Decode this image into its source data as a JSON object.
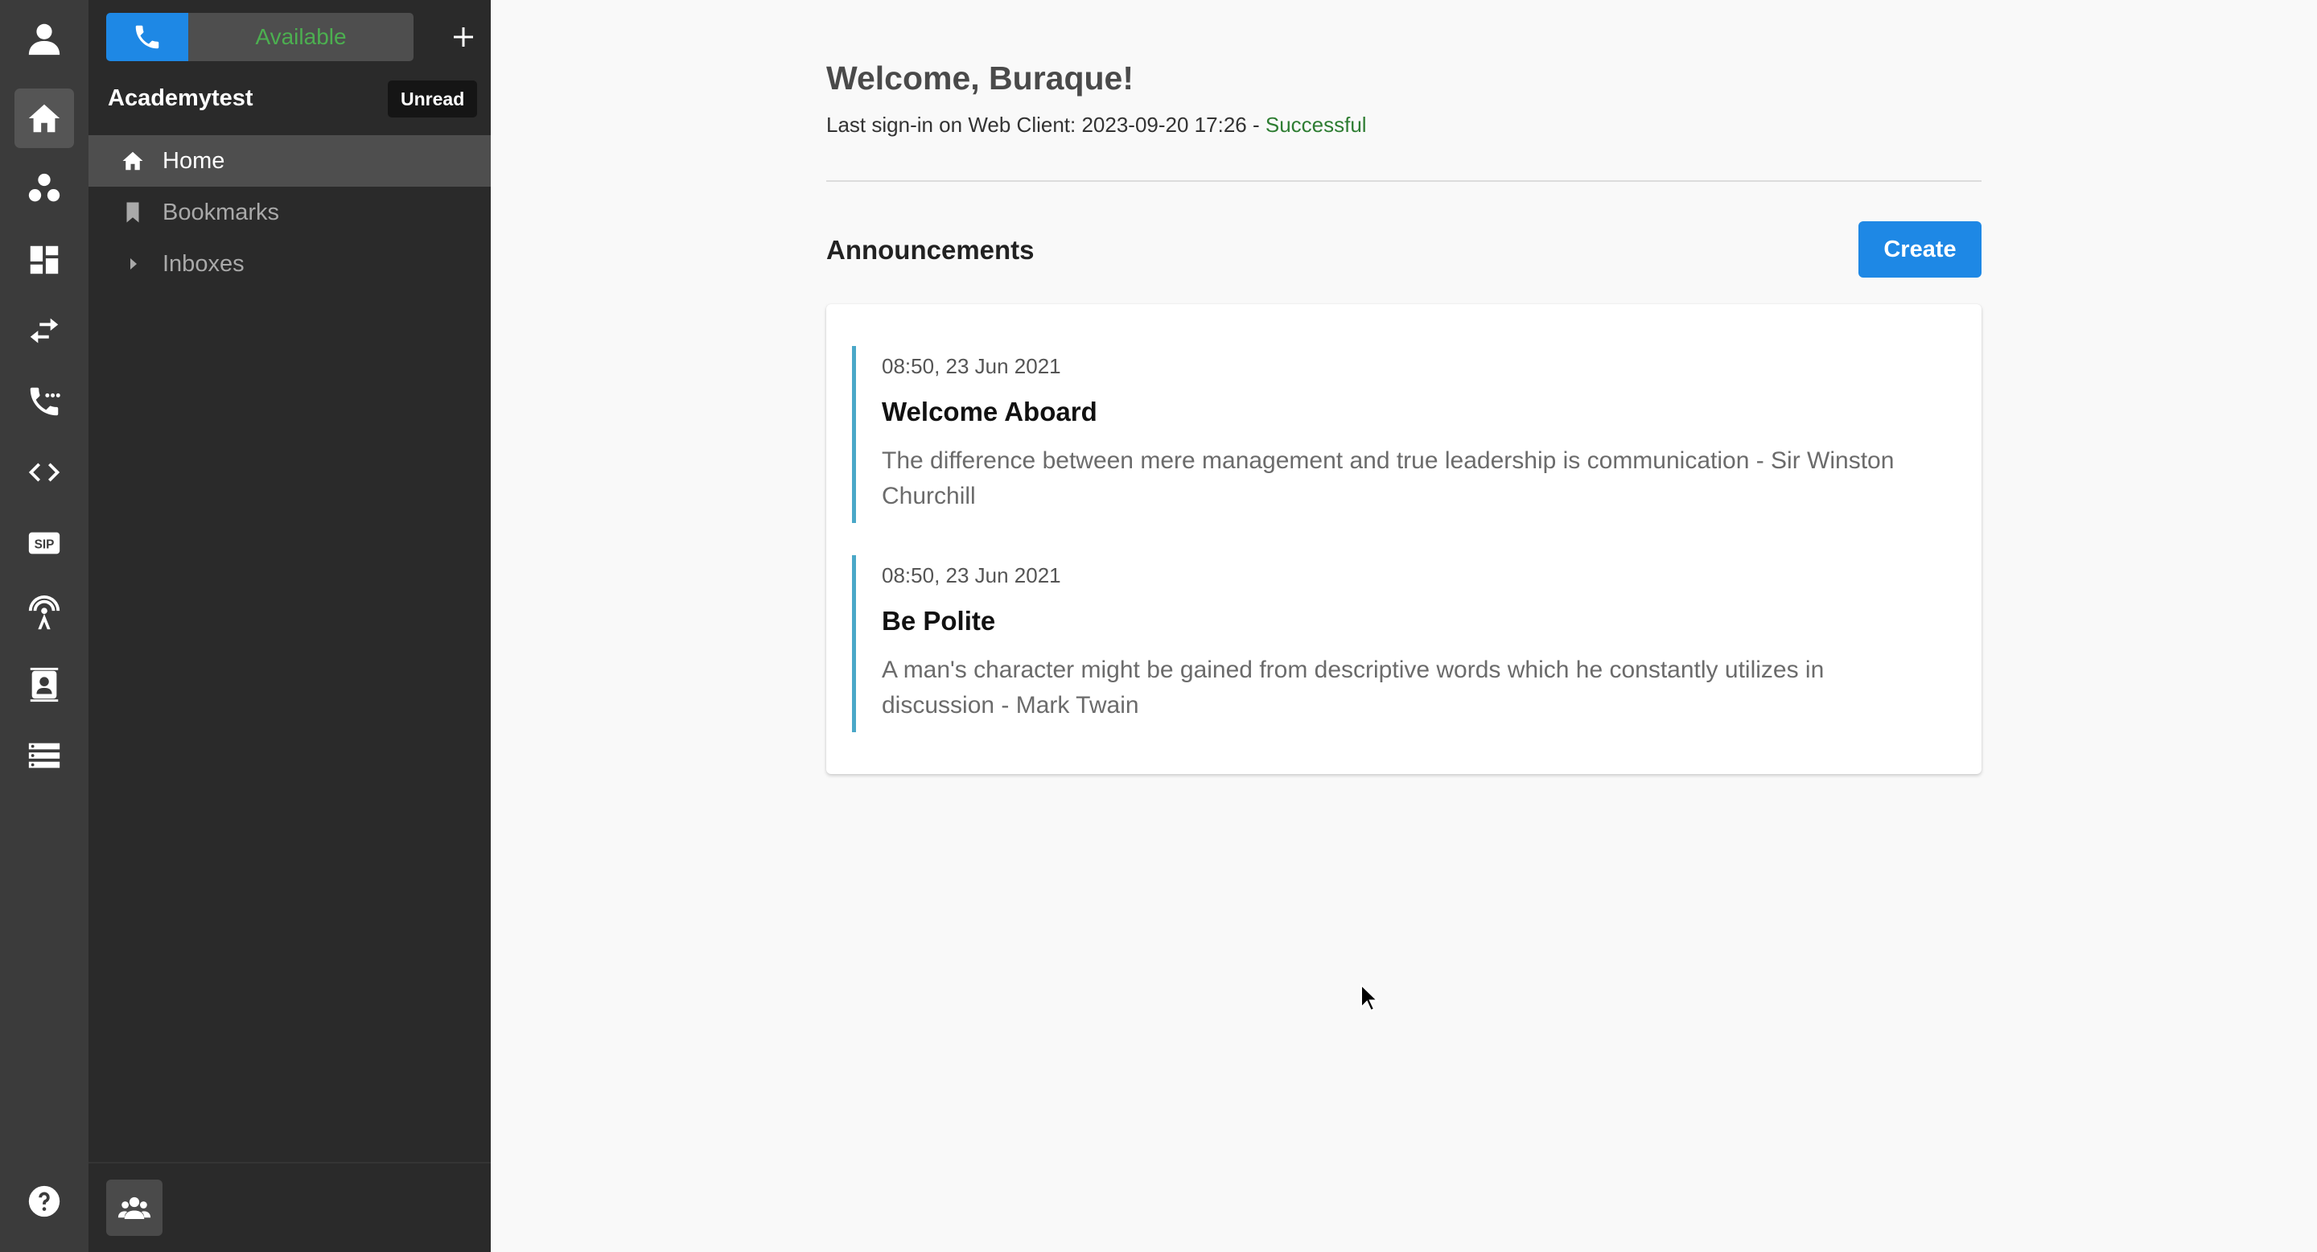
{
  "rail": {
    "icons": [
      "user-icon",
      "home-icon",
      "contacts-group-icon",
      "dashboard-icon",
      "swap-arrows-icon",
      "phone-call-icon",
      "code-icon",
      "sip-icon",
      "broadcast-icon",
      "address-book-icon",
      "server-list-icon",
      "help-icon"
    ],
    "sip_label": "SIP"
  },
  "sidebar": {
    "status": "Available",
    "tenant": "Academytest",
    "unread_label": "Unread",
    "items": [
      {
        "label": "Home",
        "icon": "home-icon",
        "active": true
      },
      {
        "label": "Bookmarks",
        "icon": "bookmark-icon",
        "active": false
      },
      {
        "label": "Inboxes",
        "icon": "caret-right-icon",
        "active": false
      }
    ]
  },
  "main": {
    "welcome": "Welcome, Buraque!",
    "last_signin_prefix": "Last sign-in on Web Client: 2023-09-20 17:26 - ",
    "last_signin_status": "Successful",
    "announcements_title": "Announcements",
    "create_label": "Create",
    "announcements": [
      {
        "date": "08:50, 23 Jun 2021",
        "title": "Welcome Aboard",
        "body": "The difference between mere management and true leadership is communication - Sir Winston Churchill"
      },
      {
        "date": "08:50, 23 Jun 2021",
        "title": "Be Polite",
        "body": "A man's character might be gained from descriptive words which he constantly utilizes in discussion - Mark Twain"
      }
    ]
  },
  "colors": {
    "accent": "#1e88e5",
    "available": "#4caf50",
    "success": "#2e7d32",
    "announcement_border": "#4aa8c8"
  }
}
